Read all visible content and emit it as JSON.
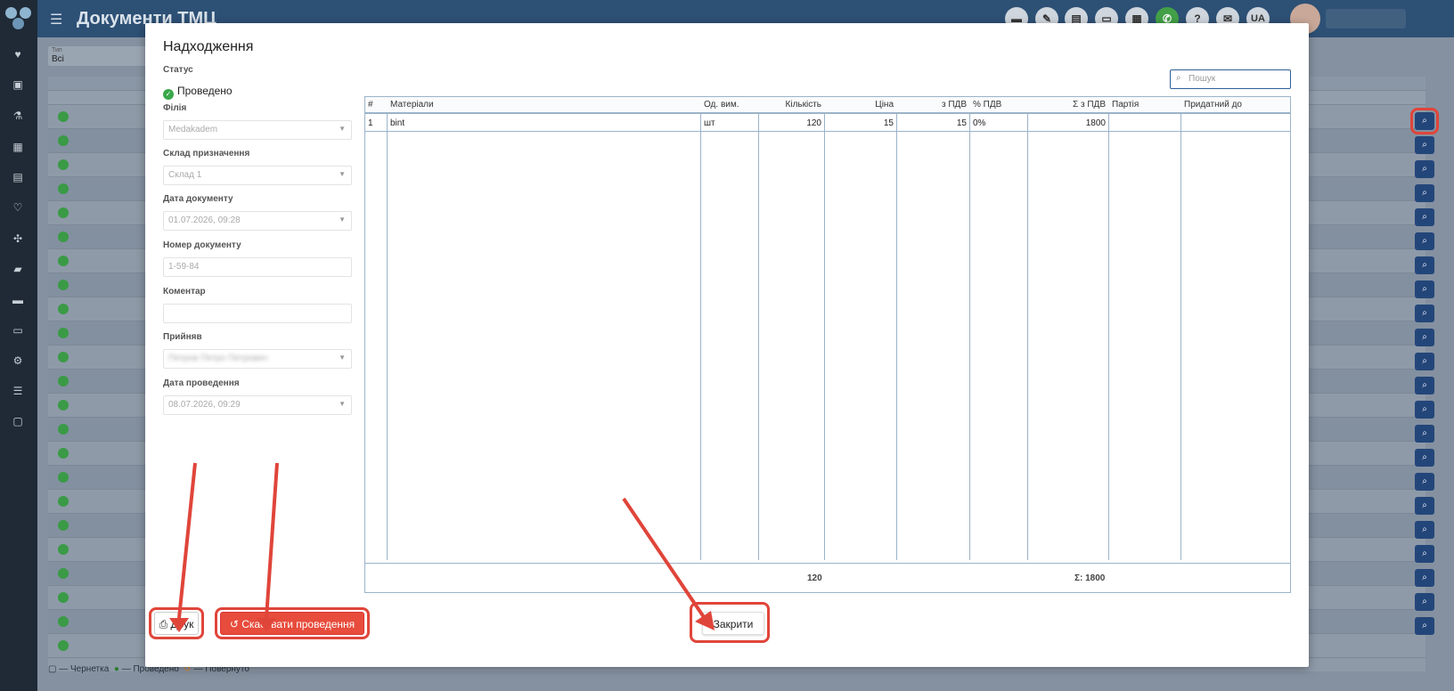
{
  "app": {
    "title": "Документи ТМЦ",
    "lang": "UA"
  },
  "topbar": {
    "icons": [
      "chat-icon",
      "attach-icon",
      "pdf-icon",
      "card-icon",
      "calculator-icon",
      "phone-icon",
      "help-icon",
      "megaphone-icon"
    ],
    "badge_count": "1"
  },
  "sidebar": {
    "icons": [
      "heart-icon",
      "contacts-icon",
      "flask-icon",
      "calendar-icon",
      "document-icon",
      "cardio-icon",
      "tools-icon",
      "book-icon",
      "folder-icon",
      "money-icon",
      "settings-icon",
      "list-icon",
      "note-icon"
    ]
  },
  "background": {
    "filter_label": "Тип",
    "filter_value": "Всі",
    "legend": {
      "draft": "— Чернетка",
      "posted": "— Проведено",
      "returned": "— Повернуто"
    }
  },
  "modal": {
    "title": "Надходження",
    "status_label": "Статус",
    "status_value": "Проведено",
    "branch_label": "Філія",
    "branch_value": "Medakadem",
    "warehouse_label": "Склад призначення",
    "warehouse_value": "Склад 1",
    "doc_date_label": "Дата документу",
    "doc_date_value": "01.07.2026, 09:28",
    "doc_number_label": "Номер документу",
    "doc_number_value": "1-59-84",
    "comment_label": "Коментар",
    "comment_value": "",
    "accepted_label": "Прийняв",
    "accepted_value": "Петров Петро Петрович",
    "post_date_label": "Дата проведення",
    "post_date_value": "08.07.2026, 09:29",
    "search_placeholder": "Пошук",
    "table": {
      "headers": [
        "#",
        "Матеріали",
        "Од. вим.",
        "Кількість",
        "Ціна",
        "з ПДВ",
        "% ПДВ",
        "Σ з ПДВ",
        "Партія",
        "Придатний до"
      ],
      "rows": [
        [
          "1",
          "bint",
          "шт",
          "120",
          "15",
          "15",
          "0%",
          "1800",
          "",
          ""
        ]
      ],
      "footer_qty": "120",
      "footer_sum": "Σ: 1800"
    },
    "print_label": "Друк",
    "cancel_label": "Скасувати проведення",
    "close_label": "Закрити"
  }
}
